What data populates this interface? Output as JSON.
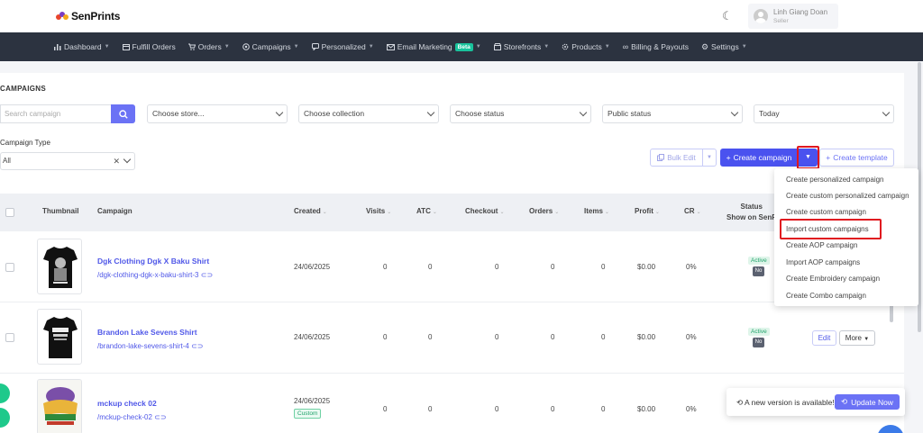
{
  "brand": {
    "name": "SenPrints"
  },
  "user": {
    "name": "Linh Giang Doan",
    "role": "Seller"
  },
  "nav": [
    {
      "label": "Dashboard",
      "icon": "bar-chart-icon",
      "has_caret": true
    },
    {
      "label": "Fulfill Orders",
      "icon": "box-icon",
      "has_caret": false
    },
    {
      "label": "Orders",
      "icon": "cart-icon",
      "has_caret": true
    },
    {
      "label": "Campaigns",
      "icon": "target-icon",
      "has_caret": true
    },
    {
      "label": "Personalized",
      "icon": "chat-icon",
      "has_caret": true
    },
    {
      "label": "Email Marketing",
      "icon": "mail-icon",
      "has_caret": true,
      "badge": "Beta"
    },
    {
      "label": "Storefronts",
      "icon": "store-icon",
      "has_caret": true
    },
    {
      "label": "Products",
      "icon": "gear-icon",
      "has_caret": true
    },
    {
      "label": "Billing & Payouts",
      "icon": "infinity-icon",
      "has_caret": false
    },
    {
      "label": "Settings",
      "icon": "settings-icon",
      "has_caret": true
    }
  ],
  "page": {
    "title": "CAMPAIGNS"
  },
  "filters": {
    "search_placeholder": "Search campaign",
    "store": "Choose store...",
    "collection": "Choose collection",
    "status": "Choose status",
    "public_status": "Public status",
    "date": "Today",
    "type_label": "Campaign Type",
    "type_value": "All"
  },
  "actions": {
    "bulk_edit": "Bulk Edit",
    "create_campaign": "Create campaign",
    "create_template": "Create template"
  },
  "dropdown": {
    "items": [
      "Create personalized campaign",
      "Create custom personalized campaign",
      "Create custom campaign",
      "Import custom campaigns",
      "Create AOP campaign",
      "Import AOP campaigns",
      "Create Embroidery campaign",
      "Create Combo campaign"
    ]
  },
  "table": {
    "headers": {
      "thumbnail": "Thumbnail",
      "campaign": "Campaign",
      "created": "Created",
      "visits": "Visits",
      "atc": "ATC",
      "checkout": "Checkout",
      "orders": "Orders",
      "items": "Items",
      "profit": "Profit",
      "cr": "CR",
      "status": "Status",
      "show_on": "Show on SenP"
    },
    "rows": [
      {
        "name": "Dgk Clothing Dgk X Baku Shirt",
        "url": "/dgk-clothing-dgk-x-baku-shirt-3",
        "created": "24/06/2025",
        "visits": "0",
        "atc": "0",
        "checkout": "0",
        "orders": "0",
        "items": "0",
        "profit": "$0.00",
        "cr": "0%",
        "status": "Active",
        "show": "No"
      },
      {
        "name": "Brandon Lake Sevens Shirt",
        "url": "/brandon-lake-sevens-shirt-4",
        "created": "24/06/2025",
        "visits": "0",
        "atc": "0",
        "checkout": "0",
        "orders": "0",
        "items": "0",
        "profit": "$0.00",
        "cr": "0%",
        "status": "Active",
        "show": "No",
        "edit": "Edit",
        "more": "More"
      },
      {
        "name": "mckup check 02",
        "url": "/mckup-check-02",
        "created": "24/06/2025",
        "tag": "Custom",
        "visits": "0",
        "atc": "0",
        "checkout": "0",
        "orders": "0",
        "items": "0",
        "profit": "$0.00",
        "cr": "0%"
      }
    ]
  },
  "toast": {
    "message": "A new version is available!",
    "button": "Update Now"
  },
  "colors": {
    "nav_bg": "#2c3340",
    "primary": "#4a52ef",
    "accent": "#6b72f5",
    "success": "#21a36b",
    "highlight": "#e0181f"
  }
}
